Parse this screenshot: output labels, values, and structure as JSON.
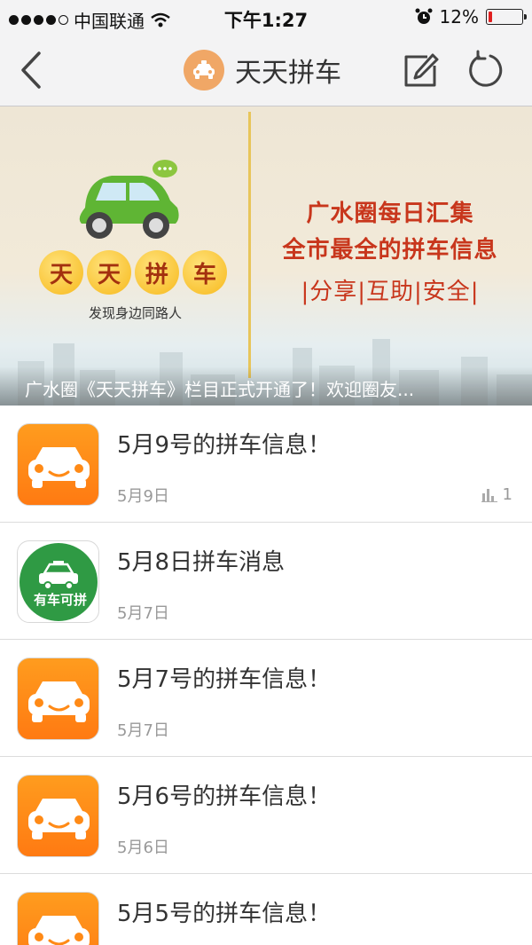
{
  "status_bar": {
    "carrier": "中国联通",
    "time": "下午1:27",
    "battery_percent": "12%",
    "battery_level": 0.12,
    "battery_color": "#e02020"
  },
  "nav": {
    "title": "天天拼车",
    "back_icon": "chevron-left-icon",
    "compose_icon": "edit-icon",
    "refresh_icon": "refresh-icon"
  },
  "banner": {
    "badges": [
      "天",
      "天",
      "拼",
      "车"
    ],
    "slogan": "发现身边同路人",
    "headline_1": "广水圈每日汇集",
    "headline_2": "全市最全的拼车信息",
    "tags_line": "|分享|互助|安全|",
    "caption": "广水圈《天天拼车》栏目正式开通了！欢迎圈友..."
  },
  "list": [
    {
      "title": "5月9号的拼车信息！",
      "date": "5月9日",
      "views": "1",
      "thumb": "orange-car"
    },
    {
      "title": "5月8日拼车消息",
      "date": "5月7日",
      "thumb": "green-car",
      "thumb_label": "有车可拼"
    },
    {
      "title": "5月7号的拼车信息！",
      "date": "5月7日",
      "thumb": "orange-car"
    },
    {
      "title": "5月6号的拼车信息！",
      "date": "5月6日",
      "thumb": "orange-car"
    },
    {
      "title": "5月5号的拼车信息！",
      "date": "",
      "thumb": "orange-car"
    }
  ],
  "colors": {
    "accent_orange": "#ff8a16",
    "headline_red": "#c8361c",
    "green": "#2f9a44"
  }
}
